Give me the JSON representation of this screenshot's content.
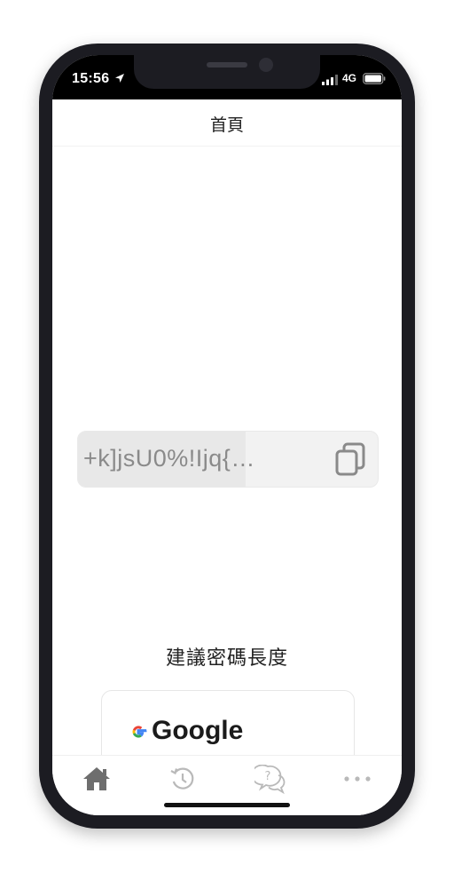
{
  "status_bar": {
    "time": "15:56",
    "network": "4G"
  },
  "header": {
    "title": "首頁"
  },
  "password": {
    "value": "+k]jsU0%!Ijq{…",
    "strength_fill": 0.56
  },
  "recommendation": {
    "heading": "建議密碼長度",
    "cards": [
      {
        "name": "Google"
      }
    ]
  },
  "tab_bar": {
    "tabs": [
      {
        "icon": "home-icon",
        "active": true
      },
      {
        "icon": "history-icon",
        "active": false
      },
      {
        "icon": "help-icon",
        "active": false
      },
      {
        "icon": "more-icon",
        "active": false
      }
    ]
  },
  "colors": {
    "frame": "#1c1c22",
    "accent_grey": "#8a8a8a",
    "active_tab": "#6e6e6e",
    "inactive_tab": "#b9b9b9"
  }
}
